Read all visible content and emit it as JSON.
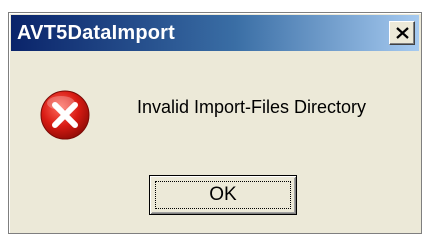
{
  "window": {
    "title": "AVT5DataImport",
    "close_icon": "close-icon"
  },
  "message": {
    "icon": "error-icon",
    "text": "Invalid Import-Files Directory"
  },
  "buttons": {
    "ok_label": "OK"
  },
  "colors": {
    "titlebar_start": "#0a246a",
    "titlebar_end": "#a6caf0",
    "dialog_background": "#ece9d8",
    "error_red": "#d81b13"
  }
}
